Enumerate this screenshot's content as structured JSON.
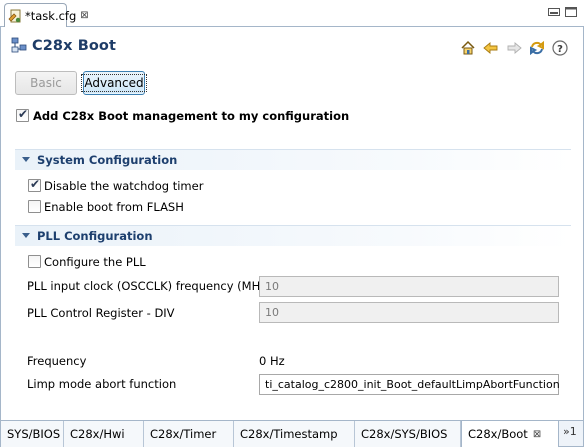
{
  "editor_tab": {
    "label": "*task.cfg",
    "close": "⊠"
  },
  "header": {
    "title": "C28x Boot"
  },
  "toolbar": {
    "icons": [
      "home-icon",
      "back-icon",
      "forward-icon",
      "refresh-icon",
      "help-icon"
    ]
  },
  "buttons": {
    "basic": "Basic",
    "advanced": "Advanced"
  },
  "add_boot": {
    "label": "Add C28x Boot management to my configuration",
    "checked": true
  },
  "system_section": {
    "title": "System Configuration",
    "disable_watchdog": {
      "label": "Disable the watchdog timer",
      "checked": true
    },
    "boot_flash": {
      "label": "Enable boot from FLASH",
      "checked": false
    }
  },
  "pll_section": {
    "title": "PLL Configuration",
    "configure_pll": {
      "label": "Configure the PLL",
      "checked": false
    },
    "input_clock": {
      "label": "PLL input clock (OSCCLK) frequency (MHz)",
      "value": "10"
    },
    "control_div": {
      "label": "PLL Control Register - DIV",
      "value": "10"
    },
    "frequency": {
      "label": "Frequency",
      "value": "0 Hz"
    },
    "limp_mode": {
      "label": "Limp mode abort function",
      "value": "ti_catalog_c2800_init_Boot_defaultLimpAbortFunction"
    }
  },
  "bottom_tabs": [
    {
      "label": "SYS/BIOS"
    },
    {
      "label": "C28x/Hwi"
    },
    {
      "label": "C28x/Timer"
    },
    {
      "label": "C28x/Timestamp"
    },
    {
      "label": "C28x/SYS/BIOS"
    },
    {
      "label": "C28x/Boot",
      "active": true,
      "close": "⊠"
    }
  ],
  "overflow": "»1",
  "colors": {
    "title": "#1e3c67",
    "section_title": "#1d3f6e",
    "accent": "#3c7fb1"
  }
}
